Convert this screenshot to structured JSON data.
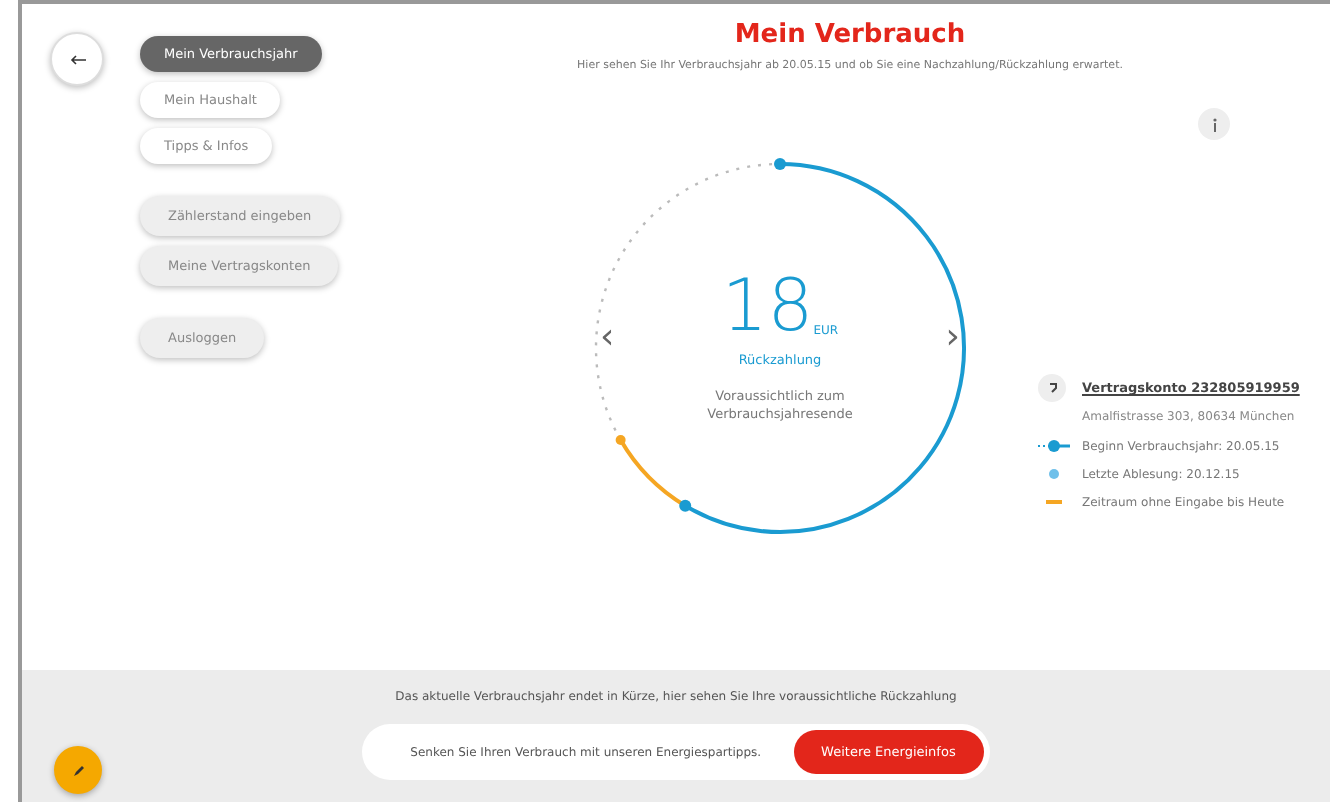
{
  "menu_groups": [
    {
      "items": [
        {
          "label": "Mein Verbrauchsjahr",
          "selected": true
        },
        {
          "label": "Mein Haushalt",
          "selected": false
        },
        {
          "label": "Tipps & Infos",
          "selected": false
        }
      ],
      "kind": "nav"
    },
    {
      "items": [
        {
          "label": "Zählerstand eingeben",
          "selected": false
        },
        {
          "label": "Meine Vertragskonten",
          "selected": false
        }
      ],
      "kind": "action"
    },
    {
      "items": [
        {
          "label": "Ausloggen",
          "selected": false
        }
      ],
      "kind": "action"
    }
  ],
  "header": {
    "title": "Mein Verbrauch",
    "subtitle": "Hier sehen Sie Ihr Verbrauchsjahr ab 20.05.15 und ob Sie eine Nachzahlung/Rückzahlung erwartet."
  },
  "gauge": {
    "amount": "18",
    "unit": "EUR",
    "label": "Rückzahlung",
    "note": "Voraussichtlich zum Verbrauchsjahresende",
    "prev": "‹",
    "next": "›"
  },
  "account": {
    "title": "Vertragskonto 232805919959",
    "address": "Amalfistrasse 303, 80634 München"
  },
  "legend": [
    {
      "kind": "start",
      "text": "Beginn Verbrauchsjahr: 20.05.15",
      "color": "#1a9bd1"
    },
    {
      "kind": "dot",
      "text": "Letzte Ablesung: 20.12.15",
      "color": "#6fc0ea"
    },
    {
      "kind": "dash",
      "text": "Zeitraum ohne Eingabe bis Heute",
      "color": "#f5a623"
    }
  ],
  "footer": {
    "notice": "Das aktuelle Verbrauchsjahr endet in Kürze, hier sehen Sie Ihre voraussichtliche Rückzahlung",
    "tip": "Senken Sie Ihren Verbrauch mit unseren Energiespartipps.",
    "button": "Weitere Energieinfos"
  }
}
